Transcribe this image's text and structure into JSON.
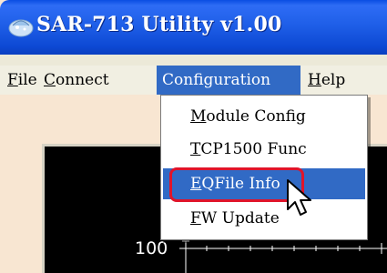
{
  "window": {
    "title": "SAR-713 Utility v1.00",
    "title_icon": "app-icon"
  },
  "menubar": {
    "items": [
      {
        "label": "File",
        "accel": "F",
        "rest": "ile"
      },
      {
        "label": "Connect",
        "accel": "C",
        "rest": "onnect"
      },
      {
        "label": "Configuration",
        "accel": "",
        "rest": "Configuration"
      },
      {
        "label": "Help",
        "accel": "H",
        "rest": "elp"
      }
    ]
  },
  "dropdown": {
    "items": [
      {
        "label": "Module Config",
        "accel": "M",
        "rest": "odule Config"
      },
      {
        "label": "TCP1500 Func",
        "accel": "T",
        "rest": "CP1500 Func"
      },
      {
        "label": "EQFile Info",
        "accel": "E",
        "rest": "QFile Info"
      },
      {
        "label": "FW Update",
        "accel": "F",
        "rest": "W Update"
      }
    ]
  },
  "chart": {
    "y_tick_label": "100"
  },
  "colors": {
    "titlebar": "#0a4de3",
    "highlight": "#316ac5",
    "annotation": "#e0142a",
    "chart_bg": "#000000"
  },
  "icons": {
    "cursor": "arrow-cursor-icon"
  }
}
